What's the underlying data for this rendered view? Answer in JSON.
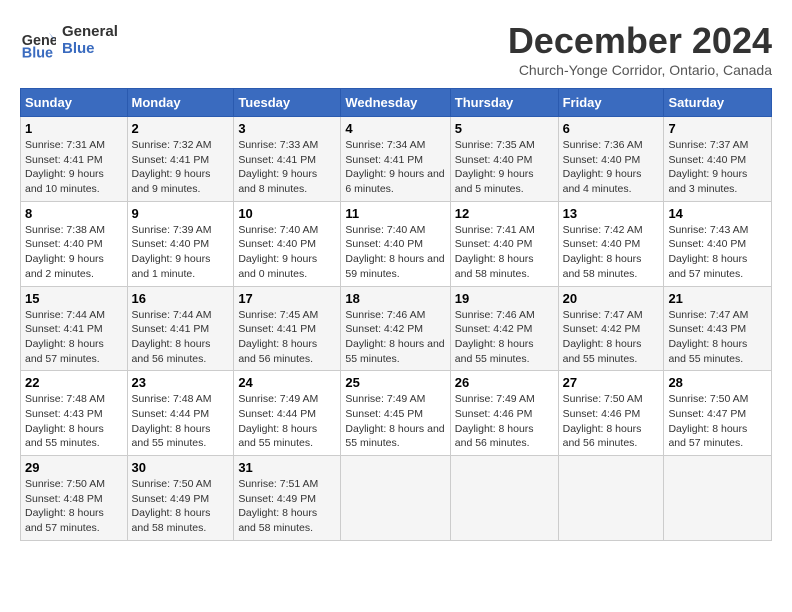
{
  "logo": {
    "line1": "General",
    "line2": "Blue"
  },
  "title": "December 2024",
  "subtitle": "Church-Yonge Corridor, Ontario, Canada",
  "days_of_week": [
    "Sunday",
    "Monday",
    "Tuesday",
    "Wednesday",
    "Thursday",
    "Friday",
    "Saturday"
  ],
  "weeks": [
    [
      {
        "day": "1",
        "sunrise": "7:31 AM",
        "sunset": "4:41 PM",
        "daylight": "9 hours and 10 minutes."
      },
      {
        "day": "2",
        "sunrise": "7:32 AM",
        "sunset": "4:41 PM",
        "daylight": "9 hours and 9 minutes."
      },
      {
        "day": "3",
        "sunrise": "7:33 AM",
        "sunset": "4:41 PM",
        "daylight": "9 hours and 8 minutes."
      },
      {
        "day": "4",
        "sunrise": "7:34 AM",
        "sunset": "4:41 PM",
        "daylight": "9 hours and 6 minutes."
      },
      {
        "day": "5",
        "sunrise": "7:35 AM",
        "sunset": "4:40 PM",
        "daylight": "9 hours and 5 minutes."
      },
      {
        "day": "6",
        "sunrise": "7:36 AM",
        "sunset": "4:40 PM",
        "daylight": "9 hours and 4 minutes."
      },
      {
        "day": "7",
        "sunrise": "7:37 AM",
        "sunset": "4:40 PM",
        "daylight": "9 hours and 3 minutes."
      }
    ],
    [
      {
        "day": "8",
        "sunrise": "7:38 AM",
        "sunset": "4:40 PM",
        "daylight": "9 hours and 2 minutes."
      },
      {
        "day": "9",
        "sunrise": "7:39 AM",
        "sunset": "4:40 PM",
        "daylight": "9 hours and 1 minute."
      },
      {
        "day": "10",
        "sunrise": "7:40 AM",
        "sunset": "4:40 PM",
        "daylight": "9 hours and 0 minutes."
      },
      {
        "day": "11",
        "sunrise": "7:40 AM",
        "sunset": "4:40 PM",
        "daylight": "8 hours and 59 minutes."
      },
      {
        "day": "12",
        "sunrise": "7:41 AM",
        "sunset": "4:40 PM",
        "daylight": "8 hours and 58 minutes."
      },
      {
        "day": "13",
        "sunrise": "7:42 AM",
        "sunset": "4:40 PM",
        "daylight": "8 hours and 58 minutes."
      },
      {
        "day": "14",
        "sunrise": "7:43 AM",
        "sunset": "4:40 PM",
        "daylight": "8 hours and 57 minutes."
      }
    ],
    [
      {
        "day": "15",
        "sunrise": "7:44 AM",
        "sunset": "4:41 PM",
        "daylight": "8 hours and 57 minutes."
      },
      {
        "day": "16",
        "sunrise": "7:44 AM",
        "sunset": "4:41 PM",
        "daylight": "8 hours and 56 minutes."
      },
      {
        "day": "17",
        "sunrise": "7:45 AM",
        "sunset": "4:41 PM",
        "daylight": "8 hours and 56 minutes."
      },
      {
        "day": "18",
        "sunrise": "7:46 AM",
        "sunset": "4:42 PM",
        "daylight": "8 hours and 55 minutes."
      },
      {
        "day": "19",
        "sunrise": "7:46 AM",
        "sunset": "4:42 PM",
        "daylight": "8 hours and 55 minutes."
      },
      {
        "day": "20",
        "sunrise": "7:47 AM",
        "sunset": "4:42 PM",
        "daylight": "8 hours and 55 minutes."
      },
      {
        "day": "21",
        "sunrise": "7:47 AM",
        "sunset": "4:43 PM",
        "daylight": "8 hours and 55 minutes."
      }
    ],
    [
      {
        "day": "22",
        "sunrise": "7:48 AM",
        "sunset": "4:43 PM",
        "daylight": "8 hours and 55 minutes."
      },
      {
        "day": "23",
        "sunrise": "7:48 AM",
        "sunset": "4:44 PM",
        "daylight": "8 hours and 55 minutes."
      },
      {
        "day": "24",
        "sunrise": "7:49 AM",
        "sunset": "4:44 PM",
        "daylight": "8 hours and 55 minutes."
      },
      {
        "day": "25",
        "sunrise": "7:49 AM",
        "sunset": "4:45 PM",
        "daylight": "8 hours and 55 minutes."
      },
      {
        "day": "26",
        "sunrise": "7:49 AM",
        "sunset": "4:46 PM",
        "daylight": "8 hours and 56 minutes."
      },
      {
        "day": "27",
        "sunrise": "7:50 AM",
        "sunset": "4:46 PM",
        "daylight": "8 hours and 56 minutes."
      },
      {
        "day": "28",
        "sunrise": "7:50 AM",
        "sunset": "4:47 PM",
        "daylight": "8 hours and 57 minutes."
      }
    ],
    [
      {
        "day": "29",
        "sunrise": "7:50 AM",
        "sunset": "4:48 PM",
        "daylight": "8 hours and 57 minutes."
      },
      {
        "day": "30",
        "sunrise": "7:50 AM",
        "sunset": "4:49 PM",
        "daylight": "8 hours and 58 minutes."
      },
      {
        "day": "31",
        "sunrise": "7:51 AM",
        "sunset": "4:49 PM",
        "daylight": "8 hours and 58 minutes."
      },
      null,
      null,
      null,
      null
    ]
  ],
  "labels": {
    "sunrise": "Sunrise:",
    "sunset": "Sunset:",
    "daylight": "Daylight:"
  }
}
